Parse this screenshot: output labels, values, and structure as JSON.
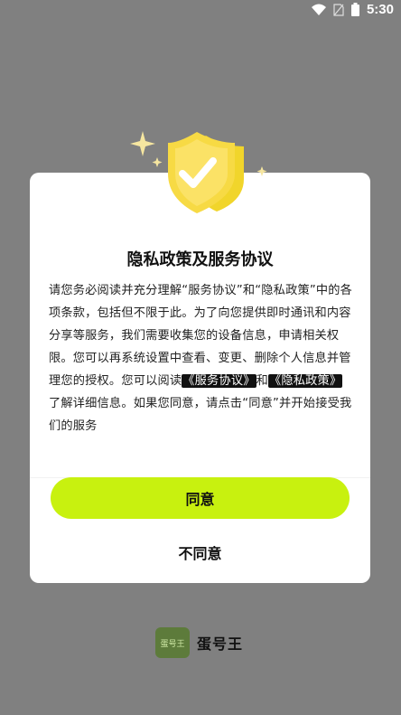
{
  "status_bar": {
    "time": "5:30",
    "icons": [
      "wifi-icon",
      "no-sim-icon",
      "battery-icon"
    ]
  },
  "dialog": {
    "title": "隐私政策及服务协议",
    "body_parts": {
      "p1": "请您务必阅读并充分理解“服务协议”和“隐私政策”中的各项条款，包括但不限于此。为了向您提供即时通讯和内容分享等服务，我们需要收集您的设备信息，申请相关权限。您可以再系统设置中查看、变更、删除个人信息并管理您的授权。您可以阅读",
      "link1": "《服务协议》",
      "and": "和",
      "link2": "《隐私政策》",
      "p2": "了解详细信息。如果您同意，请点击“同意”并开始接受我们的服务"
    },
    "agree_label": "同意",
    "disagree_label": "不同意"
  },
  "brand": {
    "logo_text": "蛋号王",
    "name": "蛋号王"
  },
  "colors": {
    "overlay": "#808080",
    "accent": "#c8f10f",
    "shield": "#f5d235"
  }
}
